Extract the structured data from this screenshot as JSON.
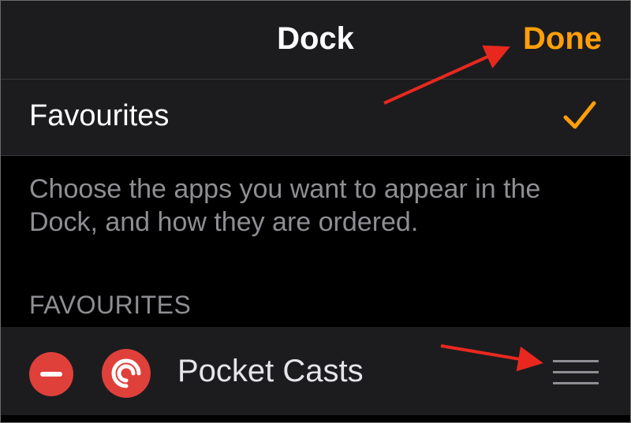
{
  "navbar": {
    "title": "Dock",
    "done_label": "Done"
  },
  "mode": {
    "label": "Favourites",
    "selected": true
  },
  "description": "Choose the apps you want to appear in the Dock, and how they are ordered.",
  "section": {
    "header": "FAVOURITES",
    "apps": [
      {
        "name": "Pocket Casts",
        "icon": "pocket-casts-icon",
        "remove_icon": "minus-circle-icon",
        "reorder_icon": "reorder-handle-icon"
      }
    ]
  },
  "colors": {
    "accent": "#ff9f0a",
    "remove": "#e0403a",
    "pocket_casts": "#e0403a",
    "annotation_arrow": "#e8281f",
    "row_background": "#1c1c1e",
    "secondary_text": "#8e8e93"
  }
}
